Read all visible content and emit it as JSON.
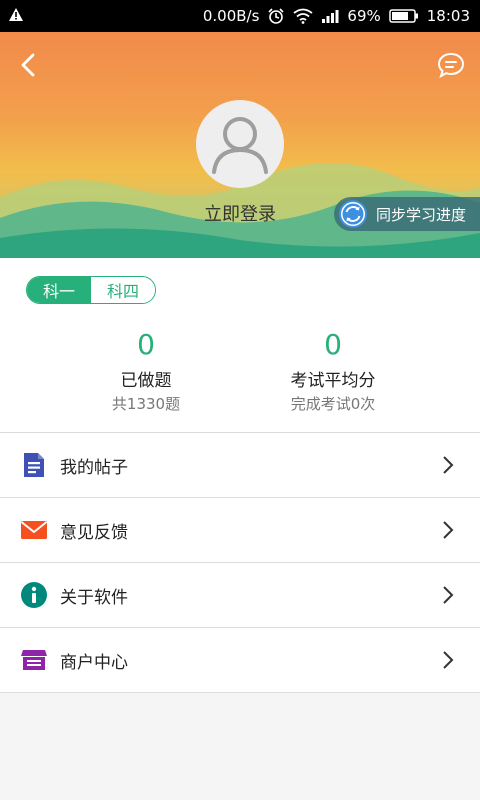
{
  "status_bar": {
    "speed": "0.00B/s",
    "battery": "69%",
    "time": "18:03"
  },
  "header": {
    "login_label": "立即登录",
    "sync_label": "同步学习进度"
  },
  "subjects": {
    "tabs": [
      "科一",
      "科四"
    ],
    "active": "科一"
  },
  "stats": {
    "done": {
      "value": "0",
      "title": "已做题",
      "sub": "共1330题"
    },
    "avg": {
      "value": "0",
      "title": "考试平均分",
      "sub": "完成考试0次"
    }
  },
  "menu": [
    {
      "label": "我的帖子",
      "icon": "document-icon",
      "color": "#3f51b5"
    },
    {
      "label": "意见反馈",
      "icon": "envelope-icon",
      "color": "#f4511e"
    },
    {
      "label": "关于软件",
      "icon": "info-icon",
      "color": "#00897b"
    },
    {
      "label": "商户中心",
      "icon": "store-icon",
      "color": "#8e24aa"
    }
  ],
  "colors": {
    "accent": "#27b07a"
  }
}
